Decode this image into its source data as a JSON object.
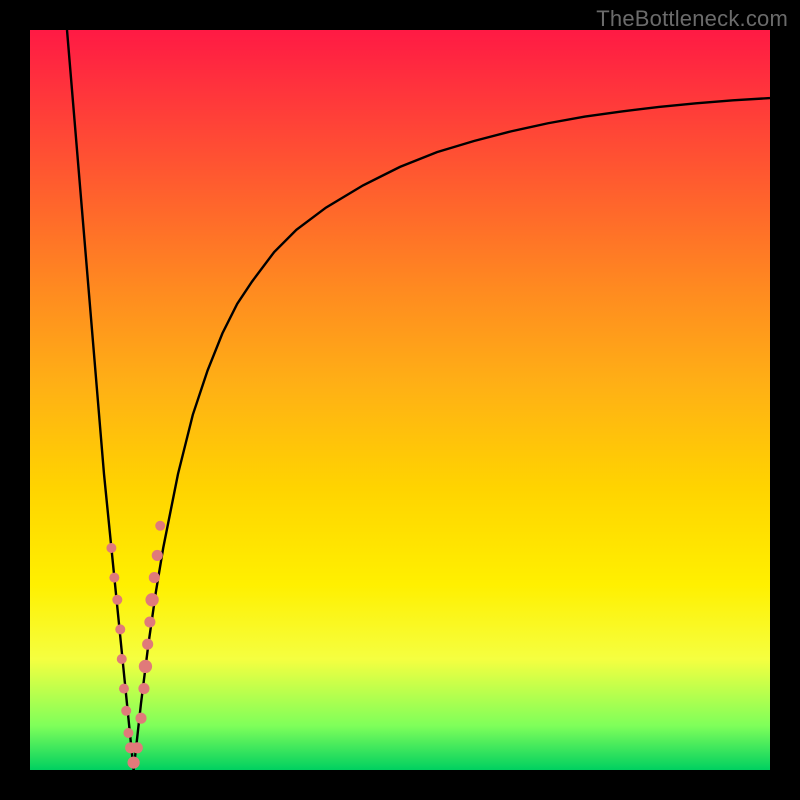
{
  "attribution": "TheBottleneck.com",
  "colors": {
    "frame": "#000000",
    "gradient_top": "#ff1a44",
    "gradient_mid": "#ffd400",
    "gradient_bottom": "#00d060",
    "curve": "#000000",
    "marker": "#e07a7a"
  },
  "chart_data": {
    "type": "line",
    "title": "",
    "xlabel": "",
    "ylabel": "",
    "xlim": [
      0,
      100
    ],
    "ylim": [
      0,
      100
    ],
    "grid": false,
    "legend": false,
    "x_minimum": 14,
    "series": [
      {
        "name": "left-branch",
        "x": [
          5,
          6,
          7,
          8,
          9,
          10,
          11,
          12,
          13,
          14
        ],
        "y": [
          100,
          88,
          76,
          64,
          52,
          40,
          30,
          20,
          10,
          0
        ]
      },
      {
        "name": "right-branch",
        "x": [
          14,
          15,
          16,
          17,
          18,
          19,
          20,
          22,
          24,
          26,
          28,
          30,
          33,
          36,
          40,
          45,
          50,
          55,
          60,
          65,
          70,
          75,
          80,
          85,
          90,
          95,
          100
        ],
        "y": [
          0,
          9,
          17,
          24,
          30,
          35,
          40,
          48,
          54,
          59,
          63,
          66,
          70,
          73,
          76,
          79,
          81.5,
          83.5,
          85,
          86.3,
          87.4,
          88.3,
          89,
          89.6,
          90.1,
          90.5,
          90.8
        ]
      }
    ],
    "markers": [
      {
        "x": 11.0,
        "y": 30,
        "r": 0.9
      },
      {
        "x": 11.4,
        "y": 26,
        "r": 0.9
      },
      {
        "x": 11.8,
        "y": 23,
        "r": 0.9
      },
      {
        "x": 12.2,
        "y": 19,
        "r": 0.9
      },
      {
        "x": 12.4,
        "y": 15,
        "r": 0.9
      },
      {
        "x": 12.7,
        "y": 11,
        "r": 0.9
      },
      {
        "x": 13.0,
        "y": 8,
        "r": 0.9
      },
      {
        "x": 13.3,
        "y": 5,
        "r": 0.9
      },
      {
        "x": 13.6,
        "y": 3,
        "r": 1.0
      },
      {
        "x": 14.0,
        "y": 1,
        "r": 1.1
      },
      {
        "x": 14.5,
        "y": 3,
        "r": 1.0
      },
      {
        "x": 15.0,
        "y": 7,
        "r": 1.0
      },
      {
        "x": 15.4,
        "y": 11,
        "r": 1.0
      },
      {
        "x": 15.6,
        "y": 14,
        "r": 1.2
      },
      {
        "x": 15.9,
        "y": 17,
        "r": 1.0
      },
      {
        "x": 16.2,
        "y": 20,
        "r": 1.0
      },
      {
        "x": 16.5,
        "y": 23,
        "r": 1.2
      },
      {
        "x": 16.8,
        "y": 26,
        "r": 1.0
      },
      {
        "x": 17.2,
        "y": 29,
        "r": 1.0
      },
      {
        "x": 17.6,
        "y": 33,
        "r": 0.9
      }
    ]
  }
}
